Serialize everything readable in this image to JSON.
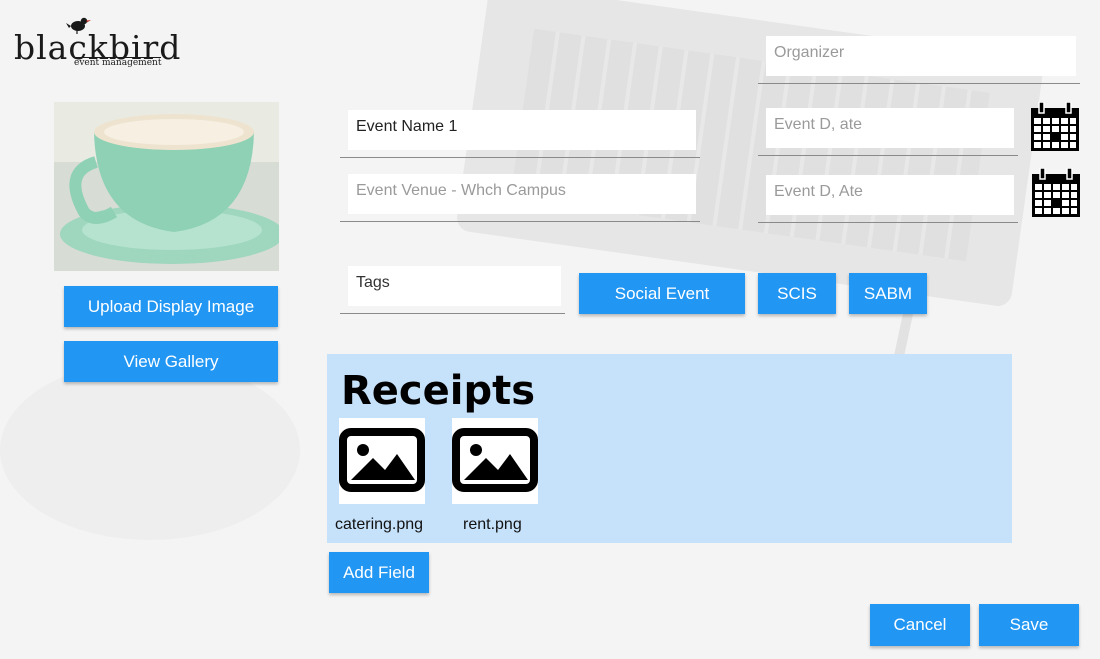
{
  "logo": {
    "word": "blackbird",
    "tagline": "event management"
  },
  "left_panel": {
    "upload_label": "Upload Display Image",
    "gallery_label": "View Gallery"
  },
  "form": {
    "organizer_placeholder": "Organizer",
    "event_name_value": "Event Name 1",
    "event_venue_placeholder": "Event Venue - Whch Campus",
    "start_date_placeholder": "Event D, ate",
    "end_date_placeholder": "Event D, Ate",
    "tags_placeholder": "Tags",
    "tags": [
      "Social Event",
      "SCIS",
      "SABM"
    ]
  },
  "receipts": {
    "title": "Receipts",
    "files": [
      {
        "name": "catering.png",
        "icon": "image-file-icon"
      },
      {
        "name": "rent.png",
        "icon": "image-file-icon"
      }
    ]
  },
  "actions": {
    "add_field_label": "Add Field",
    "cancel_label": "Cancel",
    "save_label": "Save"
  },
  "colors": {
    "primary_button": "#2196f3",
    "receipts_panel": "#c6e1fa"
  }
}
